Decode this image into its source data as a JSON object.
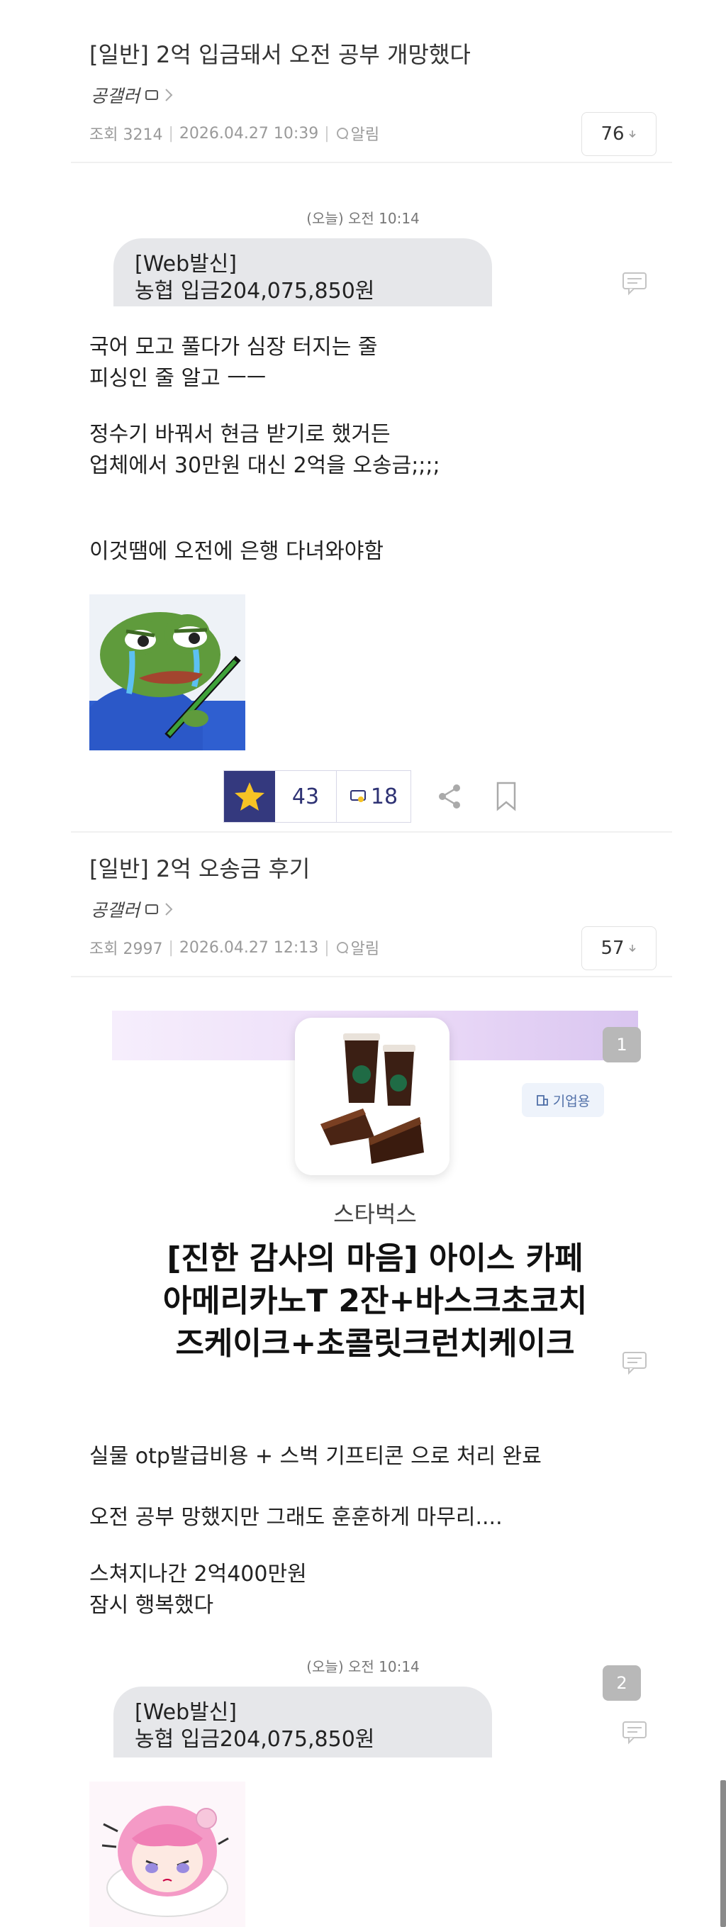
{
  "post1": {
    "title": "[일반] 2억 입금돼서 오전 공부 개망했다",
    "author": "공갤러",
    "views_label": "조회 3214",
    "datetime": "2026.04.27 10:39",
    "alert_label": "알림",
    "comment_count": "76",
    "sms_time": "(오늘) 오전 10:14",
    "sms_line1": "[Web발신]",
    "sms_line2": "농협 입금204,075,850원",
    "paragraph1": "국어 모고 풀다가 심장 터지는 줄\n피싱인 줄 알고 ㅡㅡ",
    "paragraph2": "정수기 바꿔서 현금 받기로 했거든\n업체에서 30만원 대신 2억을 오송금;;;;",
    "paragraph3": "이것땜에 오전에 은행 다녀와야함",
    "recommend_count": "43",
    "reply_count": "18"
  },
  "post2": {
    "title": "[일반] 2억 오송금 후기",
    "author": "공갤러",
    "views_label": "조회 2997",
    "datetime": "2026.04.27 12:13",
    "alert_label": "알림",
    "comment_count": "57",
    "image_index_1": "1",
    "gift": {
      "corp_tag": "기업용",
      "brand": "스타벅스",
      "product_line1": "[진한 감사의 마음] 아이스 카페",
      "product_line2": "아메리카노T 2잔+바스크초코치",
      "product_line3": "즈케이크+초콜릿크런치케이크"
    },
    "paragraph1": "실물 otp발급비용 + 스벅 기프티콘 으로 처리 완료",
    "paragraph2": "오전 공부 망했지만 그래도 훈훈하게 마무리....",
    "paragraph3": "스쳐지나간 2억400만원\n잠시 행복했다",
    "sms_time": "(오늘) 오전 10:14",
    "image_index_2": "2",
    "sms_line1": "[Web발신]",
    "sms_line2": "농협 입금204,075,850원"
  },
  "colors": {
    "accent_navy": "#34397e",
    "star_yellow": "#f7c325",
    "bubble_gray": "#e6e7ea",
    "meta_gray": "#9a9a9a"
  },
  "icons": [
    "chevron-right-icon",
    "bell-icon",
    "chevron-down-icon",
    "comment-icon",
    "star-icon",
    "share-icon",
    "bookmark-icon",
    "building-icon"
  ]
}
